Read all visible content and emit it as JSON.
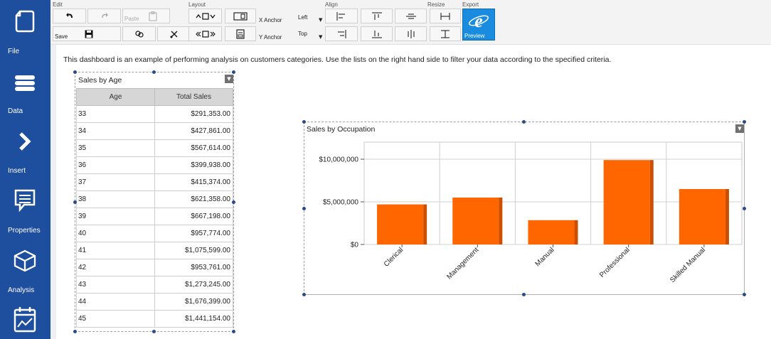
{
  "sidebar": {
    "items": [
      {
        "label": "File",
        "icon": "file-icon"
      },
      {
        "label": "Data",
        "icon": "database-icon"
      },
      {
        "label": "Insert",
        "icon": "chevron-right-icon"
      },
      {
        "label": "Properties",
        "icon": "speech-bubble-icon"
      },
      {
        "label": "Analysis",
        "icon": "cube-icon"
      },
      {
        "label": "",
        "icon": "calendar-chart-icon"
      }
    ]
  },
  "toolbar": {
    "groups": {
      "edit": "Edit",
      "layout": "Layout",
      "align": "Align",
      "resize": "Resize",
      "export": "Export"
    },
    "paste_label": "Paste",
    "save_label": "Save",
    "x_anchor_label": "X Anchor",
    "x_anchor_value": "Left",
    "y_anchor_label": "Y Anchor",
    "y_anchor_value": "Top",
    "preview_label": "Preview"
  },
  "description": "This dashboard is an example of performing analysis on customers categories. Use the lists on the right hand side to filter your data according to the specified criteria.",
  "age_widget": {
    "title": "Sales by Age",
    "columns": [
      "Age",
      "Total Sales"
    ],
    "rows": [
      [
        "33",
        "$291,353.00"
      ],
      [
        "34",
        "$427,861.00"
      ],
      [
        "35",
        "$567,614.00"
      ],
      [
        "36",
        "$399,938.00"
      ],
      [
        "37",
        "$415,374.00"
      ],
      [
        "38",
        "$621,358.00"
      ],
      [
        "39",
        "$667,198.00"
      ],
      [
        "40",
        "$957,774.00"
      ],
      [
        "41",
        "$1,075,599.00"
      ],
      [
        "42",
        "$953,761.00"
      ],
      [
        "43",
        "$1,273,245.00"
      ],
      [
        "44",
        "$1,676,399.00"
      ],
      [
        "45",
        "$1,441,154.00"
      ]
    ]
  },
  "chart_data": {
    "type": "bar",
    "title": "Sales by Occupation",
    "categories": [
      "Clerical",
      "Management",
      "Manual",
      "Professional",
      "Skilled Manual"
    ],
    "values": [
      4700000,
      5500000,
      2850000,
      9900000,
      6500000
    ],
    "ylim": [
      0,
      12000000
    ],
    "yticks": [
      0,
      5000000,
      10000000
    ],
    "ytick_labels": [
      "$0",
      "$5,000,000",
      "$10,000,000"
    ],
    "xlabel": "",
    "ylabel": "",
    "grid": true,
    "bar_color": "#ff6600",
    "bar_shade_color": "#cc4f00"
  }
}
